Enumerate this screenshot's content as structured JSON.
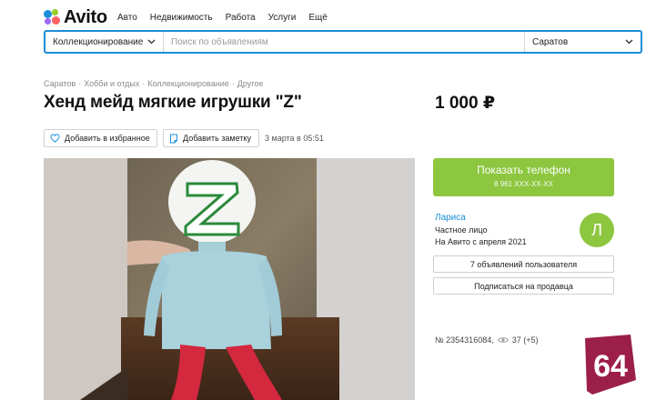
{
  "header": {
    "logo_text": "Avito",
    "nav": [
      "Авто",
      "Недвижимость",
      "Работа",
      "Услуги",
      "Ещё"
    ]
  },
  "search": {
    "category": "Коллекционирование",
    "placeholder": "Поиск по объявлениям",
    "city": "Саратов"
  },
  "breadcrumb": [
    "Саратов",
    "Хобби и отдых",
    "Коллекционирование",
    "Другое"
  ],
  "listing": {
    "title": "Хенд мейд мягкие игрушки \"Z\"",
    "price": "1 000 ₽",
    "favorite_label": "Добавить в избранное",
    "note_label": "Добавить заметку",
    "date": "3 марта в 05:51",
    "photo_letter": "Z"
  },
  "contact": {
    "show_phone_label": "Показать телефон",
    "phone_masked": "8 961 XXX-XX-XX"
  },
  "seller": {
    "name": "Лариса",
    "type": "Частное лицо",
    "since": "На Авито с апреля 2021",
    "avatar_letter": "Л",
    "ads_button": "7 объявлений пользователя",
    "subscribe_button": "Подписаться на продавца"
  },
  "stats": {
    "ad_number": "№ 2354316084,",
    "views": "37 (+5)"
  },
  "badge": {
    "text": "64"
  },
  "colors": {
    "accent_blue": "#1b8ed8",
    "green": "#8dc63f",
    "badge": "#9b1f48"
  }
}
